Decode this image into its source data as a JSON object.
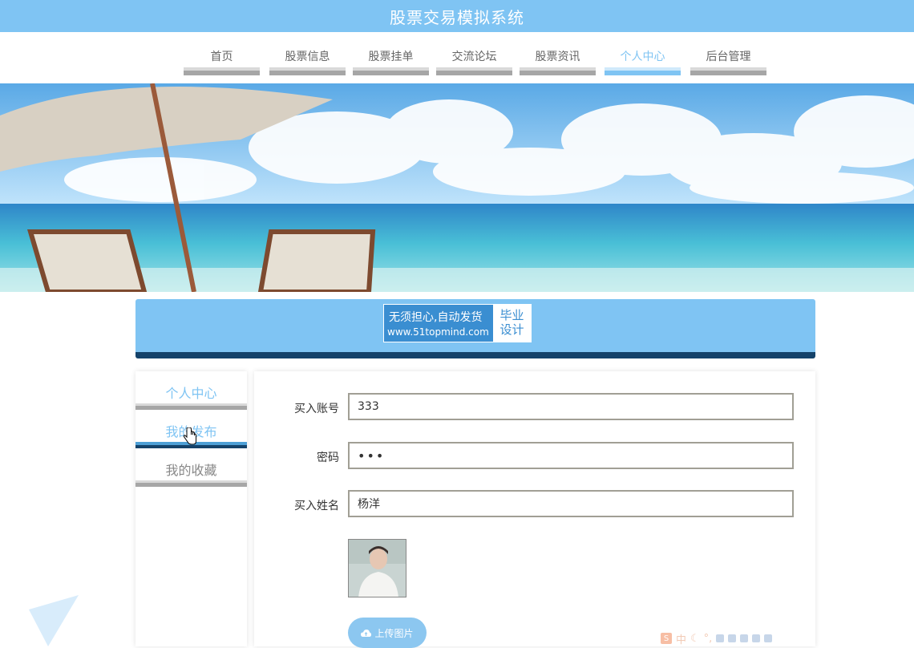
{
  "app": {
    "title": "股票交易模拟系统"
  },
  "nav": {
    "items": [
      {
        "label": "首页"
      },
      {
        "label": "股票信息"
      },
      {
        "label": "股票挂单"
      },
      {
        "label": "交流论坛"
      },
      {
        "label": "股票资讯"
      },
      {
        "label": "个人中心",
        "active": true
      },
      {
        "label": "后台管理"
      }
    ]
  },
  "ad": {
    "line1": "无须担心,自动发货",
    "line2": "www.51topmind.com",
    "badge1": "毕业",
    "badge2": "设计"
  },
  "sidebar": {
    "header": "个人中心",
    "items": [
      {
        "label": "我的发布",
        "current": true
      },
      {
        "label": "我的收藏"
      }
    ]
  },
  "form": {
    "account_label": "买入账号",
    "account_value": "333",
    "password_label": "密码",
    "password_value": "•••",
    "name_label": "买入姓名",
    "name_value": "杨洋",
    "upload_label": "上传图片"
  },
  "ime": {
    "lang": "中"
  },
  "colors": {
    "primary": "#7fc4f3",
    "dark": "#14426a",
    "gray_bar": "#a6a6a6"
  }
}
